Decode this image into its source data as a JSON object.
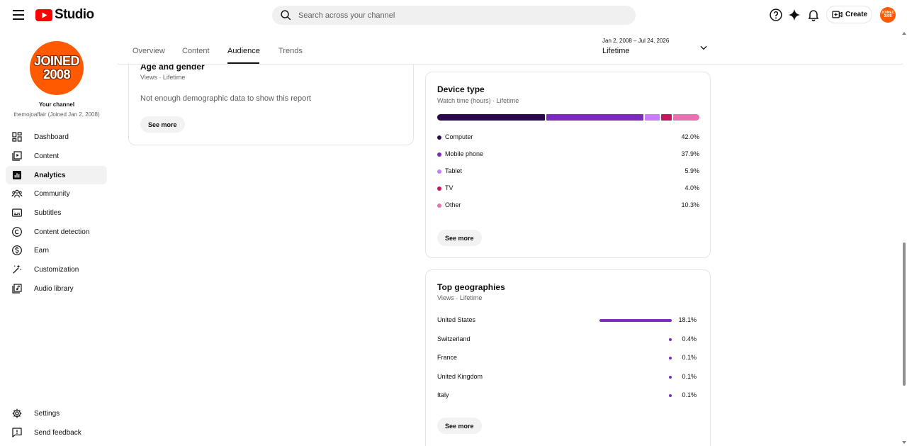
{
  "header": {
    "logo_text": "Studio",
    "search_placeholder": "Search across your channel",
    "create_label": "Create",
    "avatar_lines": [
      "JOINED",
      "2008"
    ]
  },
  "sidebar": {
    "avatar_lines": [
      "JOINED",
      "2008"
    ],
    "your_channel": "Your channel",
    "channel_info": "themojoaffair (Joined Jan 2, 2008)",
    "items": [
      {
        "label": "Dashboard",
        "icon": "dashboard-icon"
      },
      {
        "label": "Content",
        "icon": "content-icon"
      },
      {
        "label": "Analytics",
        "icon": "analytics-icon"
      },
      {
        "label": "Community",
        "icon": "community-icon"
      },
      {
        "label": "Subtitles",
        "icon": "subtitles-icon"
      },
      {
        "label": "Content detection",
        "icon": "copyright-icon"
      },
      {
        "label": "Earn",
        "icon": "dollar-icon"
      },
      {
        "label": "Customization",
        "icon": "magic-wand-icon"
      },
      {
        "label": "Audio library",
        "icon": "audio-library-icon"
      }
    ],
    "bottom_items": [
      {
        "label": "Settings",
        "icon": "gear-icon"
      },
      {
        "label": "Send feedback",
        "icon": "feedback-icon"
      }
    ]
  },
  "tabs": [
    {
      "label": "Overview"
    },
    {
      "label": "Content"
    },
    {
      "label": "Audience"
    },
    {
      "label": "Trends"
    }
  ],
  "active_tab": "Audience",
  "date_picker": {
    "range": "Jan 2, 2008 – Jul 24, 2026",
    "label": "Lifetime"
  },
  "age_gender": {
    "title": "Age and gender",
    "subtitle": "Views · Lifetime",
    "empty_message": "Not enough demographic data to show this report",
    "see_more": "See more"
  },
  "device_type": {
    "title": "Device type",
    "subtitle": "Watch time (hours) · Lifetime",
    "see_more": "See more",
    "rows": [
      {
        "name": "Computer",
        "value": "42.0%",
        "share": 42.0,
        "color": "#2a0a4a"
      },
      {
        "name": "Mobile phone",
        "value": "37.9%",
        "share": 37.9,
        "color": "#7b2cbf"
      },
      {
        "name": "Tablet",
        "value": "5.9%",
        "share": 5.9,
        "color": "#c77dff"
      },
      {
        "name": "TV",
        "value": "4.0%",
        "share": 4.0,
        "color": "#c2185b"
      },
      {
        "name": "Other",
        "value": "10.3%",
        "share": 10.3,
        "color": "#e573b0"
      }
    ]
  },
  "top_geographies": {
    "title": "Top geographies",
    "subtitle": "Views · Lifetime",
    "see_more": "See more",
    "rows": [
      {
        "name": "United States",
        "value": "18.1%",
        "share": 18.1
      },
      {
        "name": "Switzerland",
        "value": "0.4%",
        "share": 0.4
      },
      {
        "name": "France",
        "value": "0.1%",
        "share": 0.1
      },
      {
        "name": "United Kingdom",
        "value": "0.1%",
        "share": 0.1
      },
      {
        "name": "Italy",
        "value": "0.1%",
        "share": 0.1
      }
    ]
  },
  "colors": {
    "accent": "#7b2cbf",
    "brand_red": "#ff0000",
    "avatar_orange": "#ff5a00"
  }
}
